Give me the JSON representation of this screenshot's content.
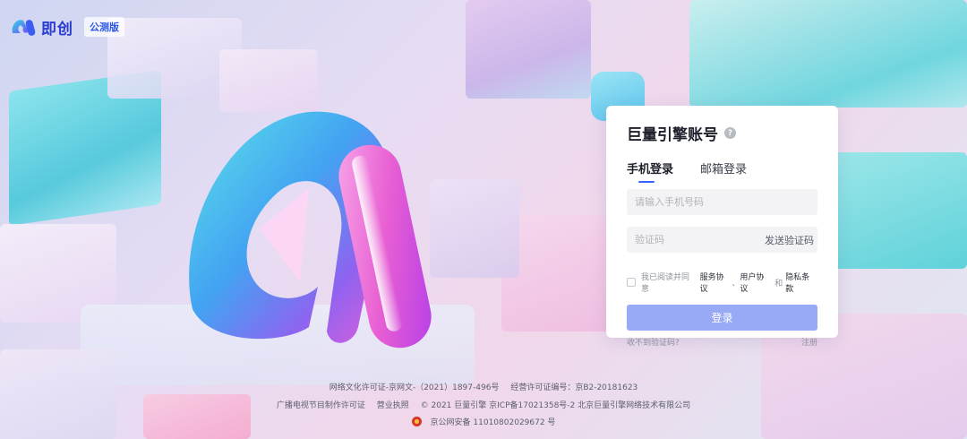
{
  "brand": {
    "name": "即创",
    "badge": "公测版"
  },
  "login": {
    "title": "巨量引擎账号",
    "tabs": [
      "手机登录",
      "邮箱登录"
    ],
    "phone_placeholder": "请输入手机号码",
    "code_placeholder": "验证码",
    "send_code": "发送验证码",
    "agree_prefix": "我已阅读并同意",
    "agree_terms": "服务协议",
    "agree_comma": "、",
    "agree_user": "用户协议",
    "agree_and": "和",
    "agree_privacy": "隐私条款",
    "submit": "登录",
    "no_code": "收不到验证码?",
    "register": "注册"
  },
  "footer": {
    "line1": [
      "网络文化许可证-京网文-（2021）1897-496号",
      "经营许可证编号：京B2-20181623"
    ],
    "line2": [
      "广播电视节目制作许可证",
      "营业执照",
      "© 2021 巨量引擎 京ICP备17021358号-2 北京巨量引擎网络技术有限公司"
    ],
    "line3": "京公网安备 11010802029672 号"
  },
  "colors": {
    "accent": "#3760ff",
    "button": "#98a9f6",
    "brand": "#2a3bd0"
  }
}
